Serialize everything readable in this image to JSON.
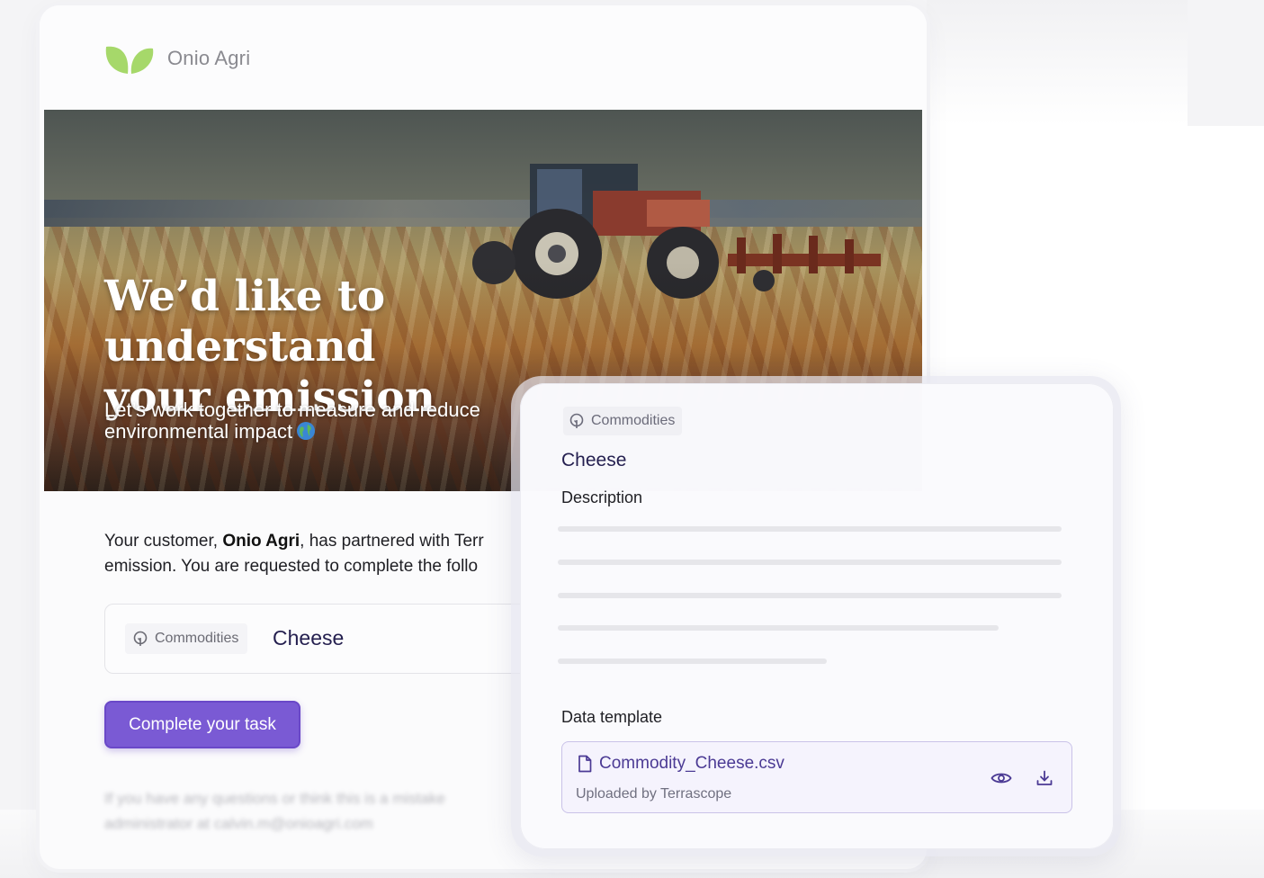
{
  "brand": {
    "name": "Onio Agri",
    "leaf_color": "#a6d86a"
  },
  "hero": {
    "title_line1": "We’d like to understand",
    "title_line2": "your emission",
    "subtitle_line1": "Let’s work together to measure and reduce",
    "subtitle_line2": "environmental impact"
  },
  "body": {
    "prefix": "Your customer, ",
    "customer": "Onio Agri",
    "line1_rest": ", has partnered with Terr",
    "line2": "emission. You are requested to complete the follo"
  },
  "task": {
    "category": "Commodities",
    "name": "Cheese"
  },
  "cta": {
    "label": "Complete your task",
    "color": "#7a5ad4"
  },
  "footer": {
    "line1": "If you have any questions or think this is a mistake",
    "line2": "administrator at calvin.m@onioagri.com"
  },
  "panel": {
    "category": "Commodities",
    "title": "Cheese",
    "description_label": "Description",
    "template_label": "Data template",
    "file": {
      "name": "Commodity_Cheese.csv",
      "uploaded_by": "Uploaded by Terrascope",
      "view_icon": "eye-icon",
      "download_icon": "download-icon"
    }
  }
}
